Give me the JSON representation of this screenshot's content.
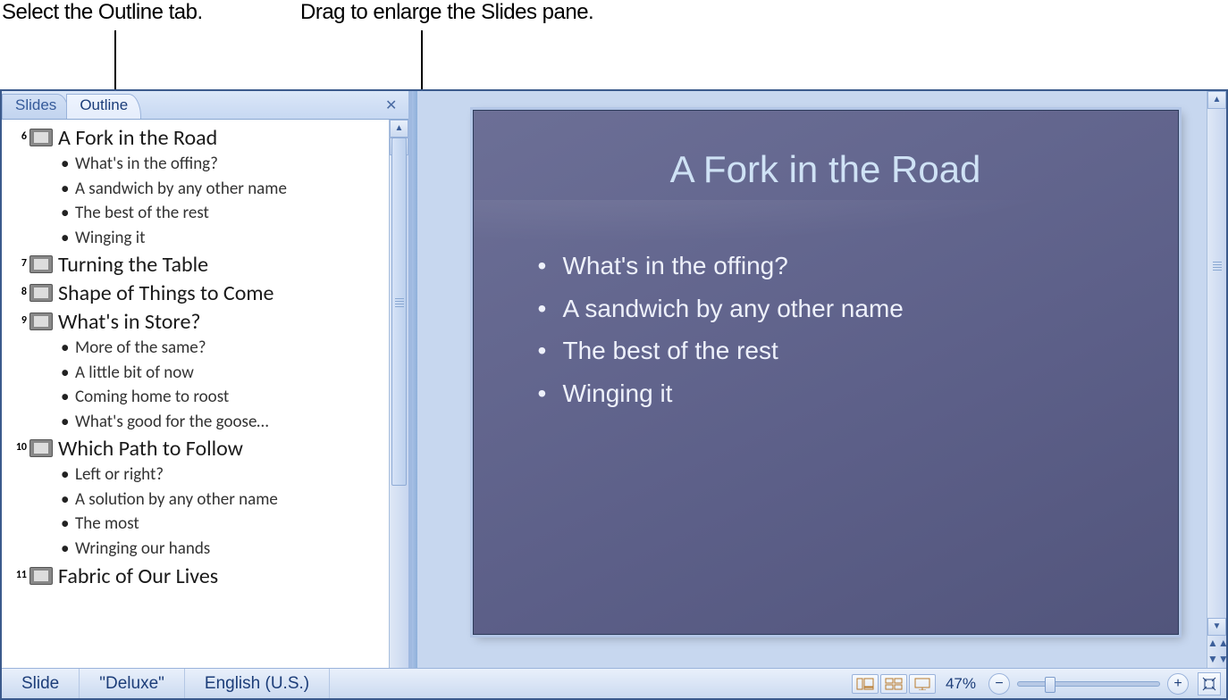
{
  "annotations": {
    "left": "Select the Outline tab.",
    "right": "Drag to enlarge the Slides pane."
  },
  "tabs": {
    "slides": "Slides",
    "outline": "Outline"
  },
  "outline": {
    "slides": [
      {
        "n": "6",
        "title": "A Fork in the Road",
        "bullets": [
          "What's in the offing?",
          "A sandwich by any other name",
          "The best of the rest",
          "Winging it"
        ]
      },
      {
        "n": "7",
        "title": "Turning the Table",
        "bullets": []
      },
      {
        "n": "8",
        "title": "Shape of Things to Come",
        "bullets": []
      },
      {
        "n": "9",
        "title": "What's in Store?",
        "bullets": [
          "More of the same?",
          "A little bit of now",
          "Coming home to roost",
          "What's good for the goose…"
        ]
      },
      {
        "n": "10",
        "title": "Which Path to Follow",
        "bullets": [
          "Left or right?",
          "A solution by any other name",
          "The most",
          "Wringing our hands"
        ]
      },
      {
        "n": "11",
        "title": "Fabric of Our Lives",
        "bullets": []
      }
    ]
  },
  "slide": {
    "title": "A Fork in the Road",
    "bullets": [
      "What's in the offing?",
      "A sandwich by any other name",
      "The best of the rest",
      "Winging it"
    ]
  },
  "status": {
    "mode": "Slide",
    "theme": "\"Deluxe\"",
    "language": "English (U.S.)",
    "zoom": "47%"
  }
}
